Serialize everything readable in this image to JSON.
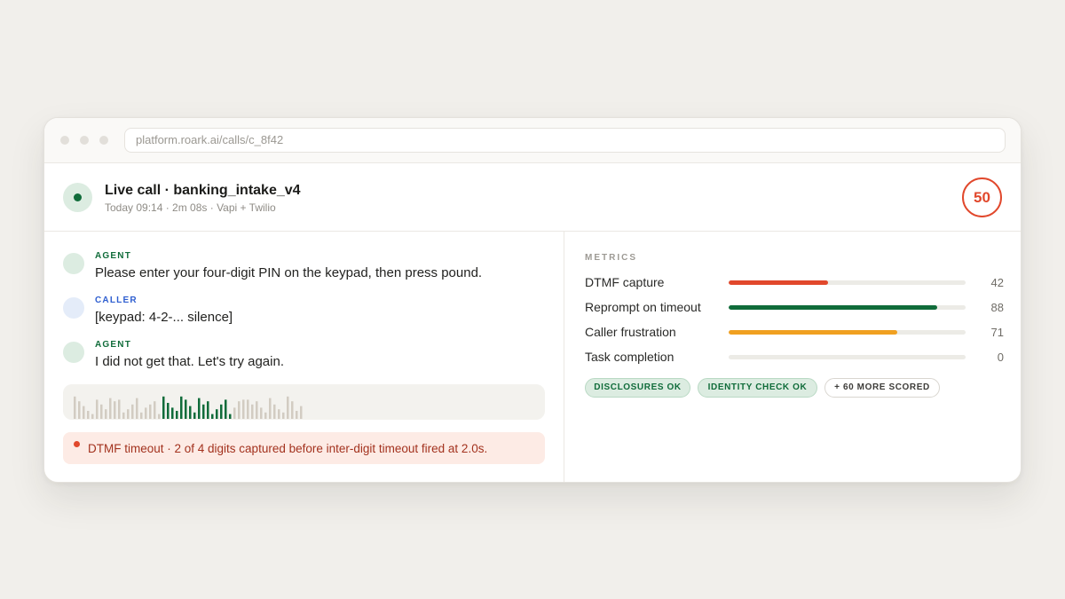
{
  "browser": {
    "url": "platform.roark.ai/calls/c_8f42"
  },
  "call": {
    "title": "Live call · banking_intake_v4",
    "subtitle": "Today 09:14 · 2m 08s · Vapi + Twilio",
    "score": "50",
    "score_color": "#e1482c"
  },
  "transcript": [
    {
      "role": "AGENT",
      "text": "Please enter your four-digit PIN on the keypad, then press pound."
    },
    {
      "role": "CALLER",
      "text": "[keypad: 4-2-... silence]"
    },
    {
      "role": "AGENT",
      "text": "I did not get that. Let's try again."
    }
  ],
  "waveform": {
    "bars": [
      0.7,
      0.55,
      0.4,
      0.25,
      0.15,
      0.6,
      0.45,
      0.3,
      0.65,
      0.55,
      0.6,
      0.2,
      0.3,
      0.45,
      0.65,
      0.2,
      0.35,
      0.45,
      0.55,
      0.15,
      0.7,
      0.5,
      0.35,
      0.25,
      0.7,
      0.6,
      0.4,
      0.2,
      0.65,
      0.45,
      0.55,
      0.15,
      0.3,
      0.45,
      0.6,
      0.15,
      0.35,
      0.55,
      0.6,
      0.6,
      0.45,
      0.55,
      0.35,
      0.2,
      0.65,
      0.45,
      0.3,
      0.2,
      0.7,
      0.55,
      0.25,
      0.4
    ],
    "highlight_start": 20,
    "highlight_end": 35,
    "base_color": "#d2ccc2",
    "highlight_color": "#106c3a"
  },
  "alert": {
    "text": "DTMF timeout · 2 of 4 digits captured before inter-digit timeout fired at 2.0s.",
    "color": "#e1482c"
  },
  "metrics": {
    "label": "METRICS",
    "items": [
      {
        "name": "DTMF capture",
        "value": 42,
        "color": "#e1482c"
      },
      {
        "name": "Reprompt on timeout",
        "value": 88,
        "color": "#106c3a"
      },
      {
        "name": "Caller frustration",
        "value": 71,
        "color": "#f0a020"
      },
      {
        "name": "Task completion",
        "value": 0,
        "color": "#cfcbc4"
      }
    ]
  },
  "chips": [
    {
      "label": "DISCLOSURES OK",
      "kind": "ok"
    },
    {
      "label": "IDENTITY CHECK OK",
      "kind": "ok"
    },
    {
      "label": "+ 60 MORE SCORED",
      "kind": "more"
    }
  ]
}
